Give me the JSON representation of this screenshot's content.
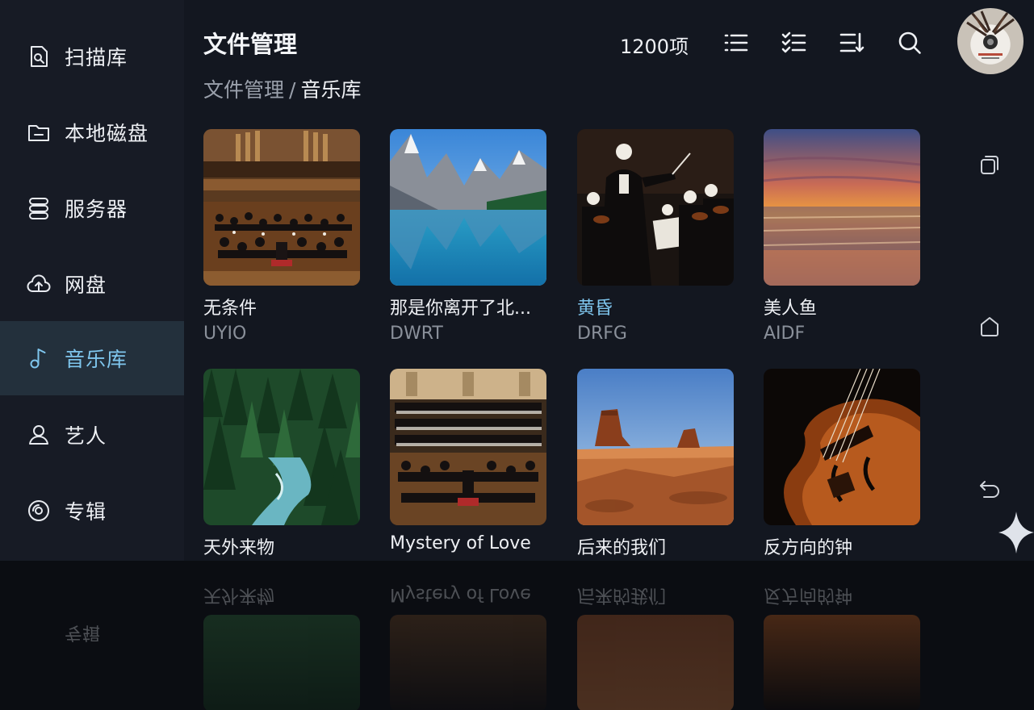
{
  "sidebar": {
    "items": [
      {
        "label": "扫描库",
        "icon": "scan-library-icon"
      },
      {
        "label": "本地磁盘",
        "icon": "folder-icon"
      },
      {
        "label": "服务器",
        "icon": "server-icon"
      },
      {
        "label": "网盘",
        "icon": "cloud-upload-icon"
      },
      {
        "label": "音乐库",
        "icon": "music-note-icon",
        "active": true
      },
      {
        "label": "艺人",
        "icon": "person-icon"
      },
      {
        "label": "专辑",
        "icon": "album-disc-icon"
      }
    ]
  },
  "header": {
    "title": "文件管理",
    "breadcrumb": {
      "root": "文件管理",
      "separator": "/",
      "current": "音乐库"
    },
    "count": "1200项",
    "tools": [
      "list-view-icon",
      "multi-select-icon",
      "sort-icon",
      "search-icon"
    ]
  },
  "grid": {
    "items": [
      {
        "title": "无条件",
        "subtitle": "UYIO",
        "image": "orchestra-hall"
      },
      {
        "title": "那是你离开了北...",
        "subtitle": "DWRT",
        "image": "mountain-lake"
      },
      {
        "title": "黄昏",
        "subtitle": "DRFG",
        "image": "conductor",
        "highlighted": true
      },
      {
        "title": "美人鱼",
        "subtitle": "AIDF",
        "image": "sunset-sea"
      },
      {
        "title": "天外来物",
        "subtitle": "",
        "image": "forest-river"
      },
      {
        "title": "Mystery of Love",
        "subtitle": "",
        "image": "choir-orchestra"
      },
      {
        "title": "后来的我们",
        "subtitle": "",
        "image": "desert-buttes"
      },
      {
        "title": "反方向的钟",
        "subtitle": "",
        "image": "violin"
      }
    ]
  },
  "rail": {
    "buttons": [
      "recent-apps-icon",
      "home-icon",
      "back-icon"
    ]
  },
  "colors": {
    "accent": "#7fc6ee",
    "sidebar_bg": "#171b25",
    "main_bg": "#131720",
    "active_bg": "#23303c"
  }
}
